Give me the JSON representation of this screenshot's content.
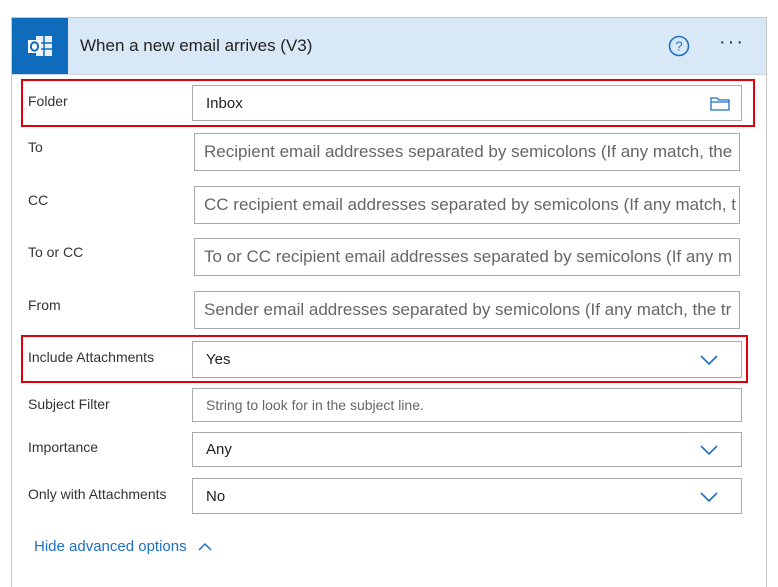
{
  "header": {
    "title": "When a new email arrives (V3)",
    "icon": "outlook-icon",
    "help_icon": "help-circle-icon",
    "more_icon": "ellipsis-icon",
    "more_text": "···",
    "accent": "#0f6cbd"
  },
  "fields": {
    "folder": {
      "label": "Folder",
      "value": "Inbox"
    },
    "to": {
      "label": "To",
      "placeholder": "Recipient email addresses separated by semicolons (If any match, the"
    },
    "cc": {
      "label": "CC",
      "placeholder": "CC recipient email addresses separated by semicolons (If any match, t"
    },
    "to_or_cc": {
      "label": "To or CC",
      "placeholder": "To or CC recipient email addresses separated by semicolons (If any m"
    },
    "from": {
      "label": "From",
      "placeholder": "Sender email addresses separated by semicolons (If any match, the tr"
    },
    "include_attachments": {
      "label": "Include Attachments",
      "value": "Yes"
    },
    "subject_filter": {
      "label": "Subject Filter",
      "placeholder": "String to look for in the subject line."
    },
    "importance": {
      "label": "Importance",
      "value": "Any"
    },
    "only_with_attachments": {
      "label": "Only with Attachments",
      "value": "No"
    }
  },
  "advanced": {
    "label": "Hide advanced options"
  },
  "highlight_color": "#e0000b"
}
